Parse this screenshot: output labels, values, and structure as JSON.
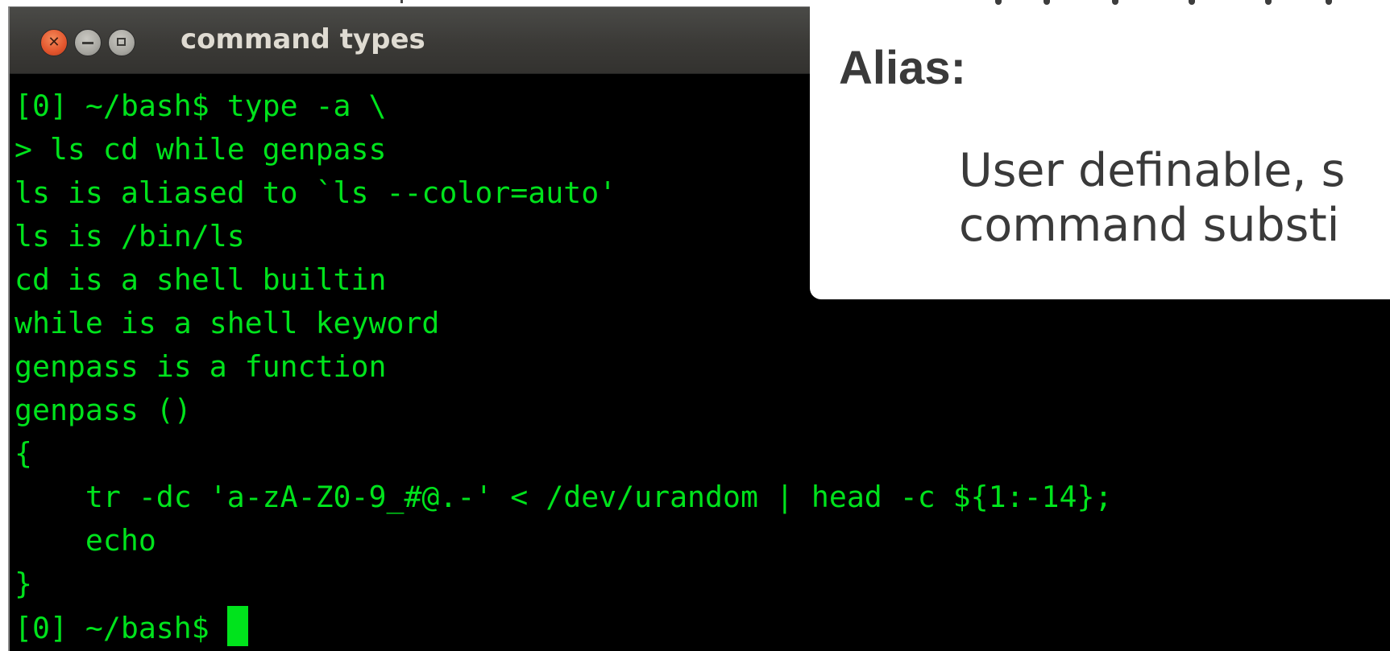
{
  "window": {
    "title": "command types"
  },
  "terminal": {
    "lines": [
      "[0] ~/bash$ type -a \\",
      "> ls cd while genpass",
      "ls is aliased to `ls --color=auto'",
      "ls is /bin/ls",
      "cd is a shell builtin",
      "while is a shell keyword",
      "genpass is a function",
      "genpass ()",
      "{",
      "    tr -dc 'a-zA-Z0-9_#@.-' < /dev/urandom | head -c ${1:-14};",
      "    echo",
      "}"
    ],
    "prompt": "[0] ~/bash$ ",
    "colors": {
      "background": "#000000",
      "foreground": "#00e31c"
    }
  },
  "slide": {
    "heading": "Alias:",
    "description_line1": "User definable, s",
    "description_line2": "command substi"
  },
  "icons": {
    "close": "close-icon",
    "minimize": "minimize-icon",
    "maximize": "maximize-icon"
  }
}
